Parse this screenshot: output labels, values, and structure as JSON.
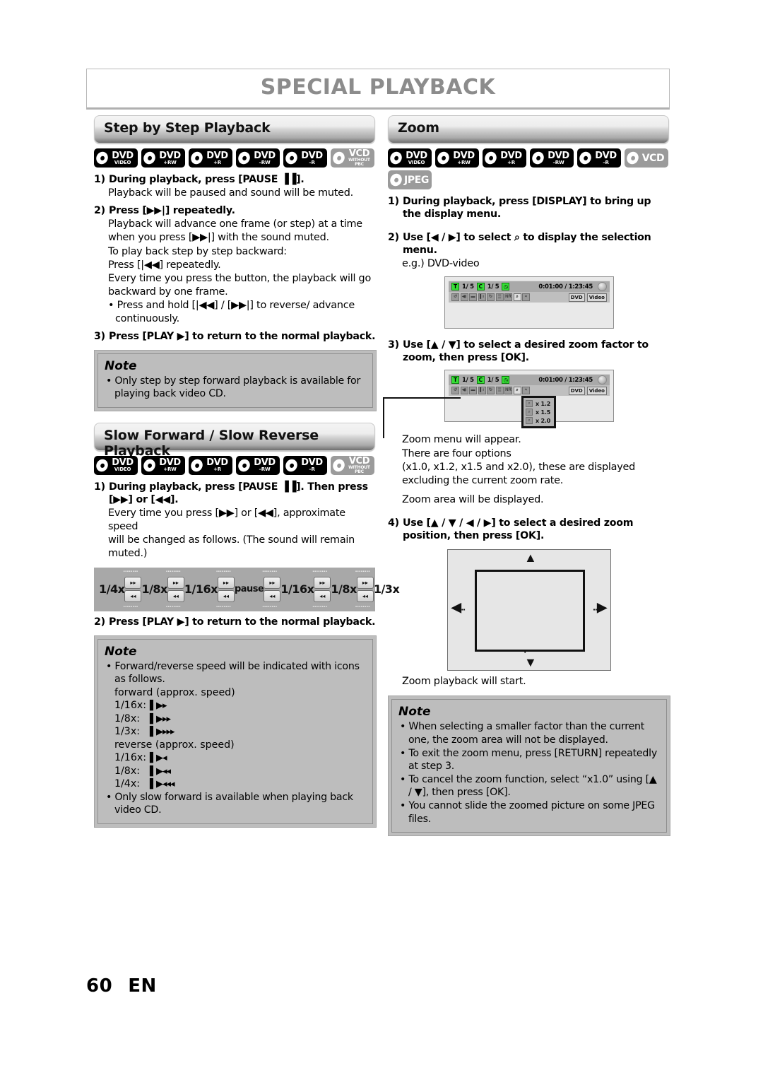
{
  "page": {
    "title": "SPECIAL PLAYBACK",
    "page_number": "60",
    "page_lang": "EN"
  },
  "left_column": {
    "section1": {
      "heading": "Step by Step Playback",
      "disc_logos": [
        {
          "name": "dvd-video",
          "line1": "DVD",
          "line2": "VIDEO",
          "style": "black"
        },
        {
          "name": "dvd-plus-rw",
          "line1": "DVD",
          "line2": "+RW",
          "style": "black"
        },
        {
          "name": "dvd-plus-r",
          "line1": "DVD",
          "line2": "+R",
          "style": "black"
        },
        {
          "name": "dvd-minus-rw",
          "line1": "DVD",
          "line2": "–RW",
          "style": "black"
        },
        {
          "name": "dvd-minus-r",
          "line1": "DVD",
          "line2": "–R",
          "style": "black"
        },
        {
          "name": "vcd-without-pbc",
          "line1": "VCD",
          "line2": "WITHOUT",
          "line3": "PBC",
          "style": "gray"
        }
      ],
      "steps": [
        {
          "num": "1)",
          "text": "During playback, press [PAUSE ▐▐]."
        },
        {
          "num": "2)",
          "text": "Press [▶▶|] repeatedly."
        },
        {
          "num": "3)",
          "text": "Press [PLAY ▶] to return to the normal playback."
        }
      ],
      "body": [
        "Playback will be paused and sound will be muted.",
        "Playback will advance one frame (or step) at a time",
        "when you press [▶▶|] with the sound muted.",
        "To play back step by step backward:",
        "Press [|◀◀] repeatedly.",
        "Every time you press the button, the playback will go",
        "backward by one frame."
      ],
      "bullet": "Press and hold [|◀◀] / [▶▶|] to reverse/ advance continuously.",
      "note": {
        "title": "Note",
        "bullets": [
          "Only step by step forward playback is available for playing back video CD."
        ]
      }
    },
    "section2": {
      "heading": "Slow Forward / Slow Reverse Playback",
      "disc_logos": [
        {
          "name": "dvd-video",
          "line1": "DVD",
          "line2": "VIDEO",
          "style": "black"
        },
        {
          "name": "dvd-plus-rw",
          "line1": "DVD",
          "line2": "+RW",
          "style": "black"
        },
        {
          "name": "dvd-plus-r",
          "line1": "DVD",
          "line2": "+R",
          "style": "black"
        },
        {
          "name": "dvd-minus-rw",
          "line1": "DVD",
          "line2": "–RW",
          "style": "black"
        },
        {
          "name": "dvd-minus-r",
          "line1": "DVD",
          "line2": "–R",
          "style": "black"
        },
        {
          "name": "vcd-without-pbc",
          "line1": "VCD",
          "line2": "WITHOUT",
          "line3": "PBC",
          "style": "gray"
        }
      ],
      "steps": [
        {
          "num": "1)",
          "text": "During playback, press [PAUSE ▐▐]. Then press [▶▶] or [◀◀]."
        },
        {
          "num": "2)",
          "text": "Press [PLAY ▶] to return to the normal playback."
        }
      ],
      "body": [
        "Every time you press [▶▶] or [◀◀], approximate speed",
        "will be changed as follows. (The sound will remain",
        "muted.)"
      ],
      "speed_diagram": {
        "labels": [
          "1/4x",
          "1/8x",
          "1/16x",
          "pause",
          "1/16x",
          "1/8x",
          "1/3x"
        ],
        "button_top": "▸▸",
        "button_bottom": "◂◂"
      },
      "note": {
        "title": "Note",
        "bullets": [
          "Forward/reverse speed will be indicated with icons as follows.",
          "Only slow forward is available when playing back video CD."
        ],
        "forward_label": "forward (approx. speed)",
        "forward_rows": [
          {
            "speed": "1/16x:",
            "icon": "▌▶▸"
          },
          {
            "speed": "1/8x:",
            "icon": "▌▶▸▸"
          },
          {
            "speed": "1/3x:",
            "icon": "▌▶▸▸▸"
          }
        ],
        "reverse_label": "reverse (approx. speed)",
        "reverse_rows": [
          {
            "speed": "1/16x:",
            "icon": "▌▶◂"
          },
          {
            "speed": "1/8x:",
            "icon": "▌▶◂◂"
          },
          {
            "speed": "1/4x:",
            "icon": "▌▶◂◂◂"
          }
        ]
      }
    }
  },
  "right_column": {
    "section": {
      "heading": "Zoom",
      "disc_logos": [
        {
          "name": "dvd-video",
          "line1": "DVD",
          "line2": "VIDEO",
          "style": "black"
        },
        {
          "name": "dvd-plus-rw",
          "line1": "DVD",
          "line2": "+RW",
          "style": "black"
        },
        {
          "name": "dvd-plus-r",
          "line1": "DVD",
          "line2": "+R",
          "style": "black"
        },
        {
          "name": "dvd-minus-rw",
          "line1": "DVD",
          "line2": "–RW",
          "style": "black"
        },
        {
          "name": "dvd-minus-r",
          "line1": "DVD",
          "line2": "–R",
          "style": "black"
        },
        {
          "name": "vcd",
          "line1": "VCD",
          "line2": "",
          "style": "gray"
        },
        {
          "name": "jpeg",
          "line1": "JPEG",
          "line2": "",
          "style": "gray"
        }
      ],
      "steps": [
        {
          "num": "1)",
          "text": "During playback, press [DISPLAY] to bring up the display menu."
        },
        {
          "num": "2)",
          "text": "Use [◀ / ▶] to select ⌕ to display the selection menu."
        },
        {
          "num": "3)",
          "text": "Use [▲ / ▼] to select a desired zoom factor to zoom, then press [OK]."
        },
        {
          "num": "4)",
          "text": "Use [▲ / ▼ / ◀ / ▶] to select a desired zoom position, then press [OK]."
        }
      ],
      "example_label": "e.g.) DVD-video",
      "osd": {
        "title_chip": "T",
        "title_value": "1/ 5",
        "chapter_chip": "C",
        "chapter_value": "1/ 5",
        "clock_chip": "◷",
        "time": "0:01:00 / 1:23:45",
        "tags": [
          "DVD",
          "Video"
        ],
        "row2_icons": [
          "angle-icon",
          "audio-icon",
          "subtitle-icon",
          "bookmark-icon",
          "repeat-icon",
          "equalizer-icon",
          "noise-reduction-icon",
          "zoom-icon",
          "marker-icon"
        ],
        "row2_labels": [
          "↺",
          "◀ı",
          "▬",
          "▌ı",
          "↻",
          "▒",
          "NR",
          "⌕",
          "≈"
        ]
      },
      "zoom_menu_options": [
        {
          "label": "x 1.2"
        },
        {
          "label": "x 1.5"
        },
        {
          "label": "x 2.0"
        }
      ],
      "body_after_zoommenu": [
        "Zoom menu will appear.",
        "There are four options",
        "(x1.0, x1.2, x1.5 and x2.0), these are displayed",
        "excluding the current zoom rate.",
        "Zoom area will be displayed."
      ],
      "body_after_area": "Zoom playback will start.",
      "note": {
        "title": "Note",
        "bullets": [
          "When selecting a smaller factor than the current one, the zoom area will not be displayed.",
          "To exit the zoom menu, press [RETURN] repeatedly at step 3.",
          "To cancel the zoom function, select “x1.0” using [▲ / ▼], then press [OK].",
          "You cannot slide the zoomed picture on some JPEG files."
        ]
      }
    }
  },
  "colors": {
    "title_gray": "#8c8c8c",
    "note_bg": "#bdbdbd",
    "speed_diagram_bg": "#a8a8a8",
    "osd_green": "#36df36",
    "osd_bar": "#a9a9a9"
  }
}
